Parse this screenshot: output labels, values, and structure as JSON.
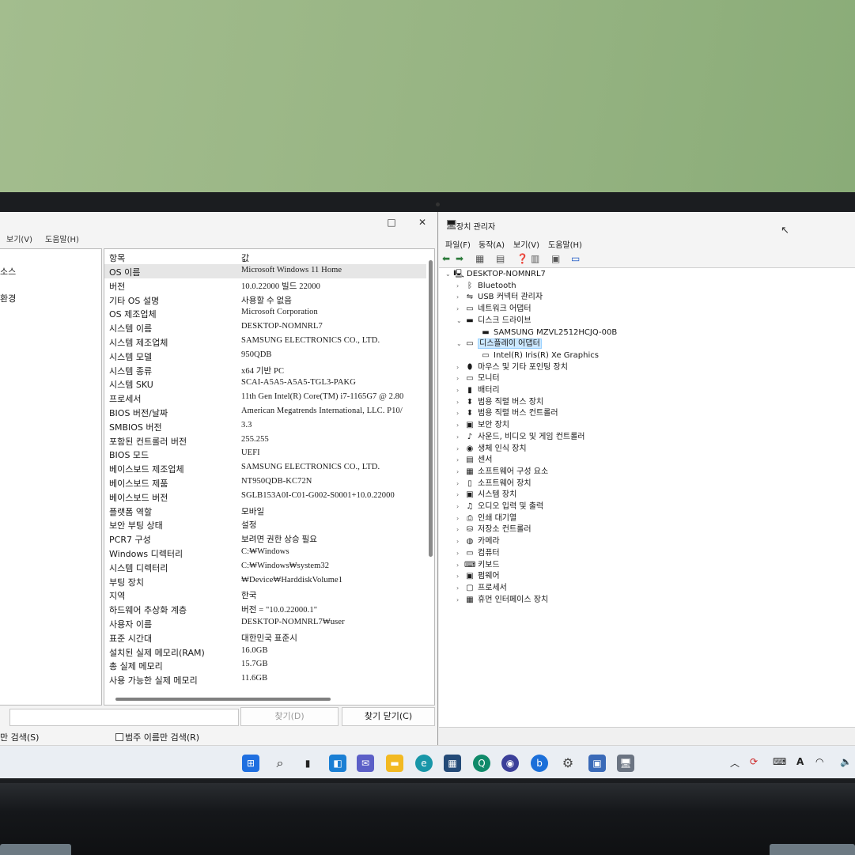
{
  "system_info": {
    "titlebar": {
      "maximize": "□",
      "close": "✕"
    },
    "menu": [
      "보기(V)",
      "도움말(H)"
    ],
    "tree": [
      "소스",
      "환경"
    ],
    "list": {
      "col_item": "항목",
      "col_value": "값",
      "rows": [
        {
          "k": "OS 이름",
          "v": "Microsoft Windows 11 Home"
        },
        {
          "k": "버전",
          "v": "10.0.22000 빌드 22000"
        },
        {
          "k": "기타 OS 설명",
          "v": "사용할 수 없음"
        },
        {
          "k": "OS 제조업체",
          "v": "Microsoft Corporation"
        },
        {
          "k": "시스템 이름",
          "v": "DESKTOP-NOMNRL7"
        },
        {
          "k": "시스템 제조업체",
          "v": "SAMSUNG ELECTRONICS CO., LTD."
        },
        {
          "k": "시스템 모델",
          "v": "950QDB"
        },
        {
          "k": "시스템 종류",
          "v": "x64 기반 PC"
        },
        {
          "k": "시스템 SKU",
          "v": "SCAI-A5A5-A5A5-TGL3-PAKG"
        },
        {
          "k": "프로세서",
          "v": "11th Gen Intel(R) Core(TM) i7-1165G7 @ 2.80"
        },
        {
          "k": "BIOS 버전/날짜",
          "v": "American Megatrends International, LLC. P10/"
        },
        {
          "k": "SMBIOS 버전",
          "v": "3.3"
        },
        {
          "k": "포함된 컨트롤러 버전",
          "v": "255.255"
        },
        {
          "k": "BIOS 모드",
          "v": "UEFI"
        },
        {
          "k": "베이스보드 제조업체",
          "v": "SAMSUNG ELECTRONICS CO., LTD."
        },
        {
          "k": "베이스보드 제품",
          "v": "NT950QDB-KC72N"
        },
        {
          "k": "베이스보드 버전",
          "v": "SGLB153A0I-C01-G002-S0001+10.0.22000"
        },
        {
          "k": "플랫폼 역할",
          "v": "모바일"
        },
        {
          "k": "보안 부팅 상태",
          "v": "설정"
        },
        {
          "k": "PCR7 구성",
          "v": "보려면 권한 상승 필요"
        },
        {
          "k": "Windows 디렉터리",
          "v": "C:₩Windows"
        },
        {
          "k": "시스템 디렉터리",
          "v": "C:₩Windows₩system32"
        },
        {
          "k": "부팅 장치",
          "v": "₩Device₩HarddiskVolume1"
        },
        {
          "k": "지역",
          "v": "한국"
        },
        {
          "k": "하드웨어 추상화 계층",
          "v": "버전 = \"10.0.22000.1\""
        },
        {
          "k": "사용자 이름",
          "v": "DESKTOP-NOMNRL7₩user"
        },
        {
          "k": "표준 시간대",
          "v": "대한민국 표준시"
        },
        {
          "k": "설치된 실제 메모리(RAM)",
          "v": "16.0GB"
        },
        {
          "k": "총 실제 메모리",
          "v": "15.7GB"
        },
        {
          "k": "사용 가능한 실제 메모리",
          "v": "11.6GB"
        }
      ]
    },
    "find_button": "찾기(D)",
    "close_find_button": "찾기 닫기(C)",
    "option_selected_only": "만 검색(S)",
    "option_category_only": "범주 이름만 검색(R)"
  },
  "device_manager": {
    "title": "장치 관리자",
    "title_icon": "device-manager-icon",
    "menu": [
      "파일(F)",
      "동작(A)",
      "보기(V)",
      "도움말(H)"
    ],
    "toolbar_icons": [
      "back-icon",
      "forward-icon",
      "properties-icon",
      "update-icon",
      "help-icon",
      "view-icon",
      "scan-icon",
      "monitor-icon"
    ],
    "root": "DESKTOP-NOMNRL7",
    "nodes": [
      {
        "label": "Bluetooth",
        "icon": "bluetooth-icon",
        "expanded": false
      },
      {
        "label": "USB 커넥터 관리자",
        "icon": "usb-icon",
        "expanded": false
      },
      {
        "label": "네트워크 어댑터",
        "icon": "network-icon",
        "expanded": false
      },
      {
        "label": "디스크 드라이브",
        "icon": "disk-icon",
        "expanded": true,
        "children": [
          "SAMSUNG MZVL2512HCJQ-00B"
        ]
      },
      {
        "label": "디스플레이 어댑터",
        "icon": "display-icon",
        "expanded": true,
        "selected": true,
        "children": [
          "Intel(R) Iris(R) Xe Graphics"
        ]
      },
      {
        "label": "마우스 및 기타 포인팅 장치",
        "icon": "mouse-icon",
        "expanded": false
      },
      {
        "label": "모니터",
        "icon": "monitor-icon",
        "expanded": false
      },
      {
        "label": "배터리",
        "icon": "battery-icon",
        "expanded": false
      },
      {
        "label": "범용 직렬 버스 장치",
        "icon": "usb-device-icon",
        "expanded": false
      },
      {
        "label": "범용 직렬 버스 컨트롤러",
        "icon": "usb-controller-icon",
        "expanded": false
      },
      {
        "label": "보안 장치",
        "icon": "security-icon",
        "expanded": false
      },
      {
        "label": "사운드, 비디오 및 게임 컨트롤러",
        "icon": "sound-icon",
        "expanded": false
      },
      {
        "label": "생체 인식 장치",
        "icon": "biometric-icon",
        "expanded": false
      },
      {
        "label": "센서",
        "icon": "sensor-icon",
        "expanded": false
      },
      {
        "label": "소프트웨어 구성 요소",
        "icon": "software-component-icon",
        "expanded": false
      },
      {
        "label": "소프트웨어 장치",
        "icon": "software-device-icon",
        "expanded": false
      },
      {
        "label": "시스템 장치",
        "icon": "system-icon",
        "expanded": false
      },
      {
        "label": "오디오 입력 및 출력",
        "icon": "audio-icon",
        "expanded": false
      },
      {
        "label": "인쇄 대기열",
        "icon": "printer-icon",
        "expanded": false
      },
      {
        "label": "저장소 컨트롤러",
        "icon": "storage-icon",
        "expanded": false
      },
      {
        "label": "카메라",
        "icon": "camera-icon",
        "expanded": false
      },
      {
        "label": "컴퓨터",
        "icon": "computer-icon",
        "expanded": false
      },
      {
        "label": "키보드",
        "icon": "keyboard-icon",
        "expanded": false
      },
      {
        "label": "펌웨어",
        "icon": "firmware-icon",
        "expanded": false
      },
      {
        "label": "프로세서",
        "icon": "processor-icon",
        "expanded": false
      },
      {
        "label": "휴먼 인터페이스 장치",
        "icon": "hid-icon",
        "expanded": false
      }
    ]
  },
  "taskbar": {
    "apps": [
      "start-icon",
      "search-icon",
      "task-view-icon",
      "widgets-icon",
      "teams-chat-icon",
      "file-explorer-icon",
      "edge-icon",
      "store-icon",
      "app-q-icon",
      "app-circle-icon",
      "app-b-icon",
      "settings-icon",
      "system-info-icon",
      "device-manager-icon"
    ],
    "tray": [
      "chevron-up-icon",
      "vpn-icon",
      "keyboard-icon",
      "ime-icon",
      "wifi-icon",
      "volume-icon"
    ],
    "ime_label": "A"
  },
  "colors": {
    "selection": "#cce8ff",
    "taskbar": "#eaeef3",
    "accent": "#0067c0"
  }
}
